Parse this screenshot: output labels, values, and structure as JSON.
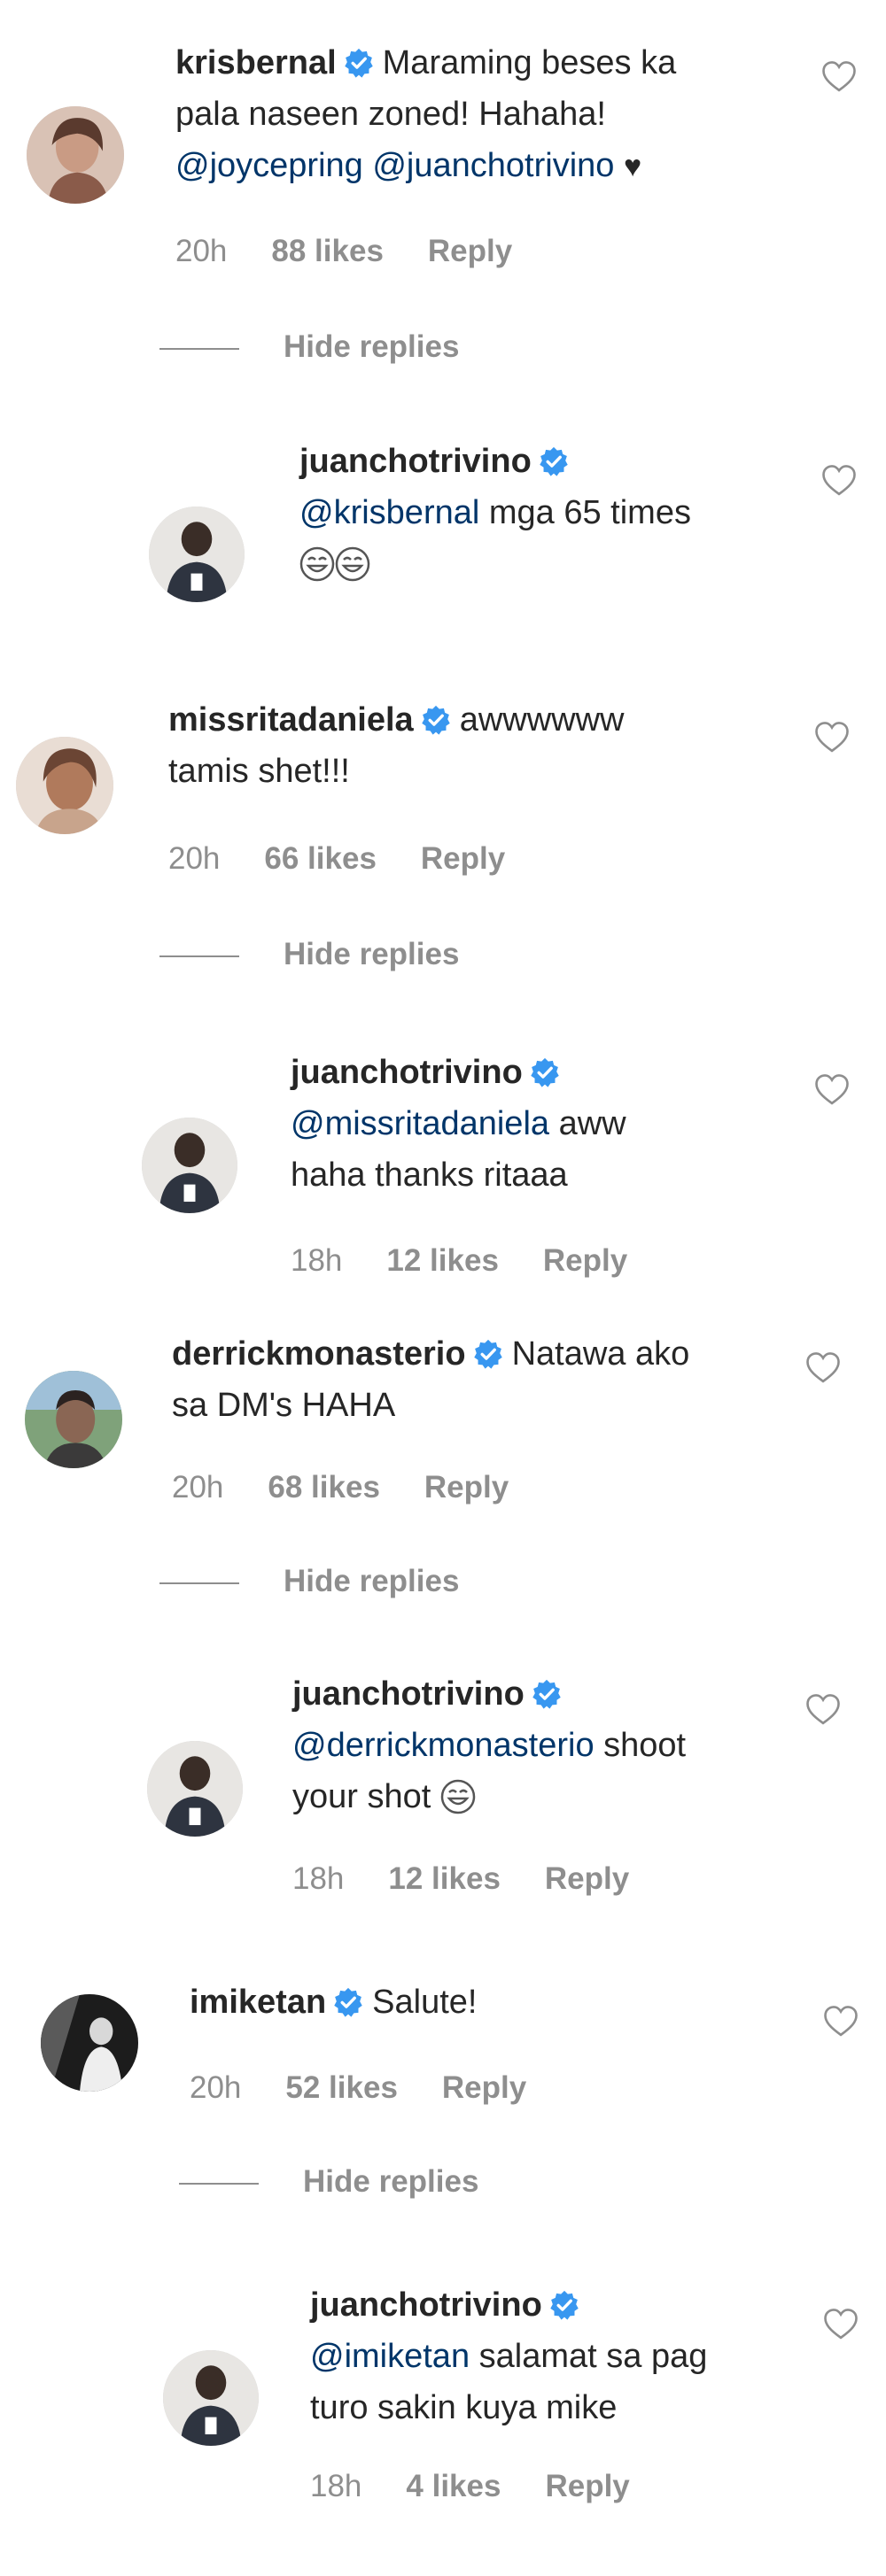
{
  "comments": [
    {
      "username": "krisbernal",
      "text_line1": "Maraming beses ka",
      "text_line2": "pala naseen zoned! Hahaha!",
      "mention1": "@joycepring",
      "mention2": "@juanchotrivino",
      "time": "20h",
      "likes": "88 likes",
      "reply": "Reply",
      "hide": "Hide replies"
    },
    {
      "username": "juanchotrivino",
      "mention": "@krisbernal",
      "text": "mga 65 times"
    },
    {
      "username": "missritadaniela",
      "text_line1": "awwwwww",
      "text_line2": "tamis shet!!!",
      "time": "20h",
      "likes": "66 likes",
      "reply": "Reply",
      "hide": "Hide replies"
    },
    {
      "username": "juanchotrivino",
      "mention": "@missritadaniela",
      "text_line1": "aww",
      "text_line2": "haha thanks ritaaa",
      "time": "18h",
      "likes": "12 likes",
      "reply": "Reply"
    },
    {
      "username": "derrickmonasterio",
      "text_line1": "Natawa ako",
      "text_line2": "sa DM's HAHA",
      "time": "20h",
      "likes": "68 likes",
      "reply": "Reply",
      "hide": "Hide replies"
    },
    {
      "username": "juanchotrivino",
      "mention": "@derrickmonasterio",
      "text_line1": "shoot",
      "text_line2": "your shot",
      "time": "18h",
      "likes": "12 likes",
      "reply": "Reply"
    },
    {
      "username": "imiketan",
      "text": "Salute!",
      "time": "20h",
      "likes": "52 likes",
      "reply": "Reply",
      "hide": "Hide replies"
    },
    {
      "username": "juanchotrivino",
      "mention": "@imiketan",
      "text_line1": "salamat sa pag",
      "text_line2": "turo sakin kuya mike",
      "time": "18h",
      "likes": "4 likes",
      "reply": "Reply"
    }
  ],
  "colors": {
    "verified": "#3897f0",
    "mention": "#003569",
    "meta": "#8e8e8e"
  }
}
